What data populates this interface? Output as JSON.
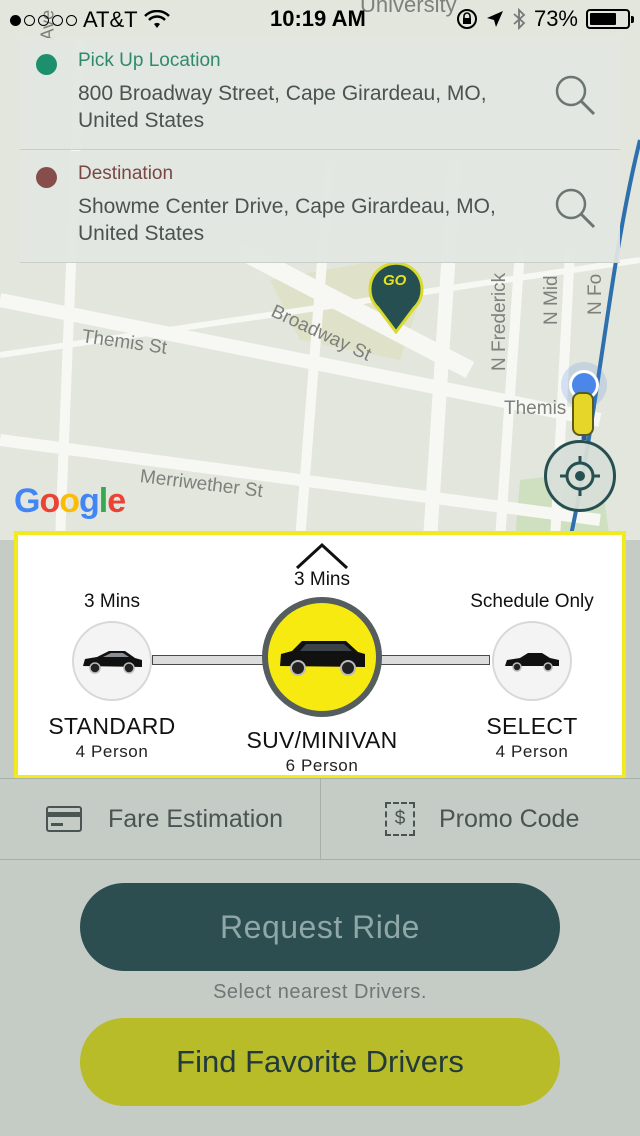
{
  "status_bar": {
    "carrier": "AT&T",
    "time": "10:19 AM",
    "battery": "73%",
    "battery_level": 0.73,
    "icons": [
      "wifi-icon",
      "lock-rotation-icon",
      "location-arrow-icon",
      "bluetooth-icon",
      "battery-icon"
    ]
  },
  "pickup": {
    "title": "Pick Up Location",
    "address": "800 Broadway Street, Cape Girardeau, MO, United States",
    "dot_color": "#1e8f6c",
    "title_color": "#2f8a6c"
  },
  "destination": {
    "title": "Destination",
    "address": "Showme Center Drive, Cape Girardeau, MO, United States",
    "dot_color": "#874d4a",
    "title_color": "#7a4744"
  },
  "map": {
    "street_labels": {
      "broadway": "Broadway St",
      "themis_w": "Themis St",
      "themis_e": "Themis",
      "merriwether": "Merriwether St",
      "n_frederick": "N Frederick",
      "n_mid": "N Mid",
      "n_fo": "N Fo",
      "top_university": "University",
      "top_ave": "Ave"
    },
    "marker_text": "GO",
    "google_logo": [
      "G",
      "o",
      "o",
      "g",
      "l",
      "e"
    ],
    "google_colors": [
      "#4285f4",
      "#ea4335",
      "#fbbc05",
      "#4285f4",
      "#34a853",
      "#ea4335"
    ]
  },
  "vehicles": {
    "standard": {
      "eta": "3 Mins",
      "name": "STANDARD",
      "capacity": "4 Person"
    },
    "suv": {
      "eta": "3 Mins",
      "name": "SUV/MINIVAN",
      "capacity": "6 Person"
    },
    "select": {
      "eta": "Schedule Only",
      "name": "SELECT",
      "capacity": "4 Person"
    },
    "selected": "suv",
    "panel_border_color": "#f2ea1f"
  },
  "options": {
    "fare": "Fare Estimation",
    "promo": "Promo Code",
    "promo_symbol": "$"
  },
  "request_button": "Request Ride",
  "hint": "Select nearest Drivers.",
  "favorite_button": "Find Favorite Drivers"
}
